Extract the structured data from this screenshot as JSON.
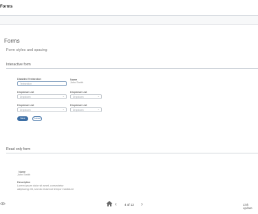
{
  "header": {
    "title": "Forms"
  },
  "page": {
    "title": "Forms",
    "subtitle": "Form styles and spacing"
  },
  "interactive": {
    "section_title": "Interactive form",
    "disabled_label": "Disabled Textsection",
    "disabled_placeholder": "Textsection",
    "name_label": "Name",
    "name_value": "John Smith",
    "dropdown_label": "Dropdown  List",
    "dropdown_placeholder": "Dropdown",
    "save_label": "Save",
    "cancel_label": "Cancel"
  },
  "readonly": {
    "section_title": "Read only form",
    "name_label": "Name",
    "name_value": "John Smith",
    "description_label": "Description",
    "description_line1": "Lorem ipsum dolor sit amet, consectetur",
    "description_line2": "adipiscing elit, sed do eiusmod tempor incididunt"
  },
  "footer": {
    "page_indicator": "4 of 12",
    "link_label": "Link update",
    "icons": [
      "eye-icon",
      "home-icon",
      "chevron-left-icon",
      "chevron-right-icon"
    ]
  }
}
